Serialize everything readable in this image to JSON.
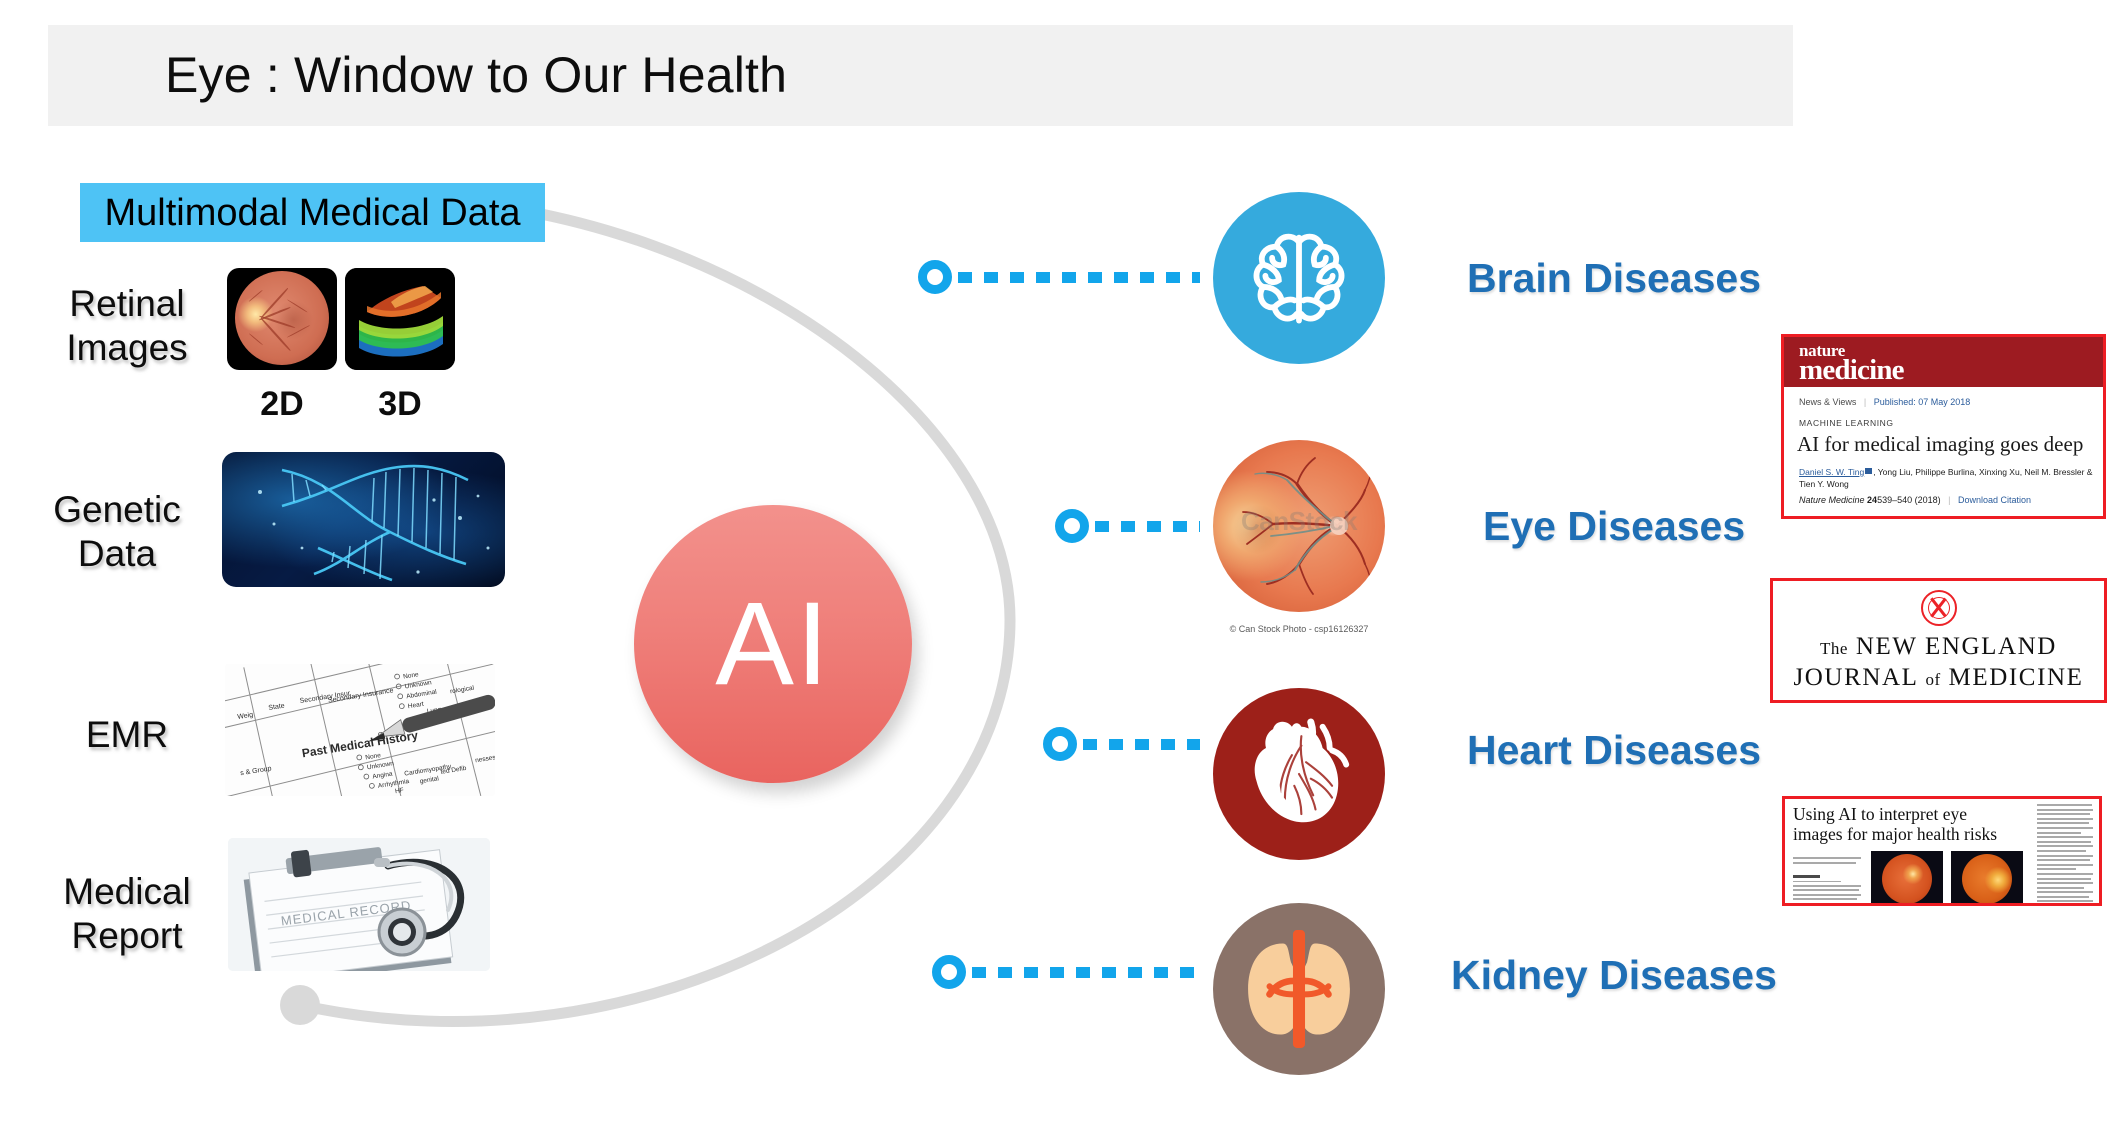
{
  "header": {
    "title": "Eye : Window to Our Health"
  },
  "inputs": {
    "banner_label": "Multimodal Medical Data",
    "rows": [
      {
        "label": "Retinal\nImages",
        "label_line1": "Retinal",
        "label_line2": "Images",
        "thumb_caption_left": "2D",
        "thumb_caption_right": "3D",
        "icon": "retina-fundus-thumbnail"
      },
      {
        "label_line1": "Genetic",
        "label_line2": "Data",
        "icon": "dna-helix-thumbnail"
      },
      {
        "label_line1": "EMR",
        "label_line2": "",
        "icon": "medical-form-thumbnail"
      },
      {
        "label_line1": "Medical",
        "label_line2": "Report",
        "icon": "clipboard-stethoscope-thumbnail"
      }
    ]
  },
  "center": {
    "ai_label": "AI",
    "color": "#ef7f7a"
  },
  "outputs": [
    {
      "label": "Brain Diseases",
      "icon": "brain-icon",
      "circle_color": "#35aadd"
    },
    {
      "label": "Eye Diseases",
      "icon": "fundus-photo-icon",
      "circle_color": "#e8794f",
      "watermark": "CanStock",
      "caption": "© Can Stock Photo - csp16126327"
    },
    {
      "label": "Heart Diseases",
      "icon": "heart-icon",
      "circle_color": "#9d2019"
    },
    {
      "label": "Kidney Diseases",
      "icon": "kidney-icon",
      "circle_color": "#8a7268"
    }
  ],
  "panels": {
    "nature_medicine": {
      "masthead_top": "nature",
      "masthead_bottom": "medicine",
      "section": "News & Views",
      "published": "Published: 07 May 2018",
      "category": "MACHINE LEARNING",
      "headline": "AI for medical imaging goes deep",
      "authors_linked": "Daniel S. W. Ting",
      "authors_rest": ", Yong Liu, Philippe Burlina, Xinxing Xu, Neil M. Bressler & Tien Y. Wong",
      "journal": "Nature Medicine",
      "volume": "24",
      "pages": "539–540 (2018)",
      "download": "Download Citation"
    },
    "nejm": {
      "line1_small": "The",
      "line1_large": "NEW ENGLAND",
      "line2_large_a": "JOURNAL",
      "line2_small": "of",
      "line2_large_b": "MEDICINE",
      "seal": "nejm-seal-icon"
    },
    "news_clipping": {
      "headline": "Using AI to interpret eye images for major health risks",
      "photos": [
        "fundus-photo-left",
        "fundus-photo-right"
      ]
    }
  },
  "decor": {
    "arc": "background-arc",
    "arc_color": "#d9d9d9",
    "connector_color": "#12a5eb"
  }
}
